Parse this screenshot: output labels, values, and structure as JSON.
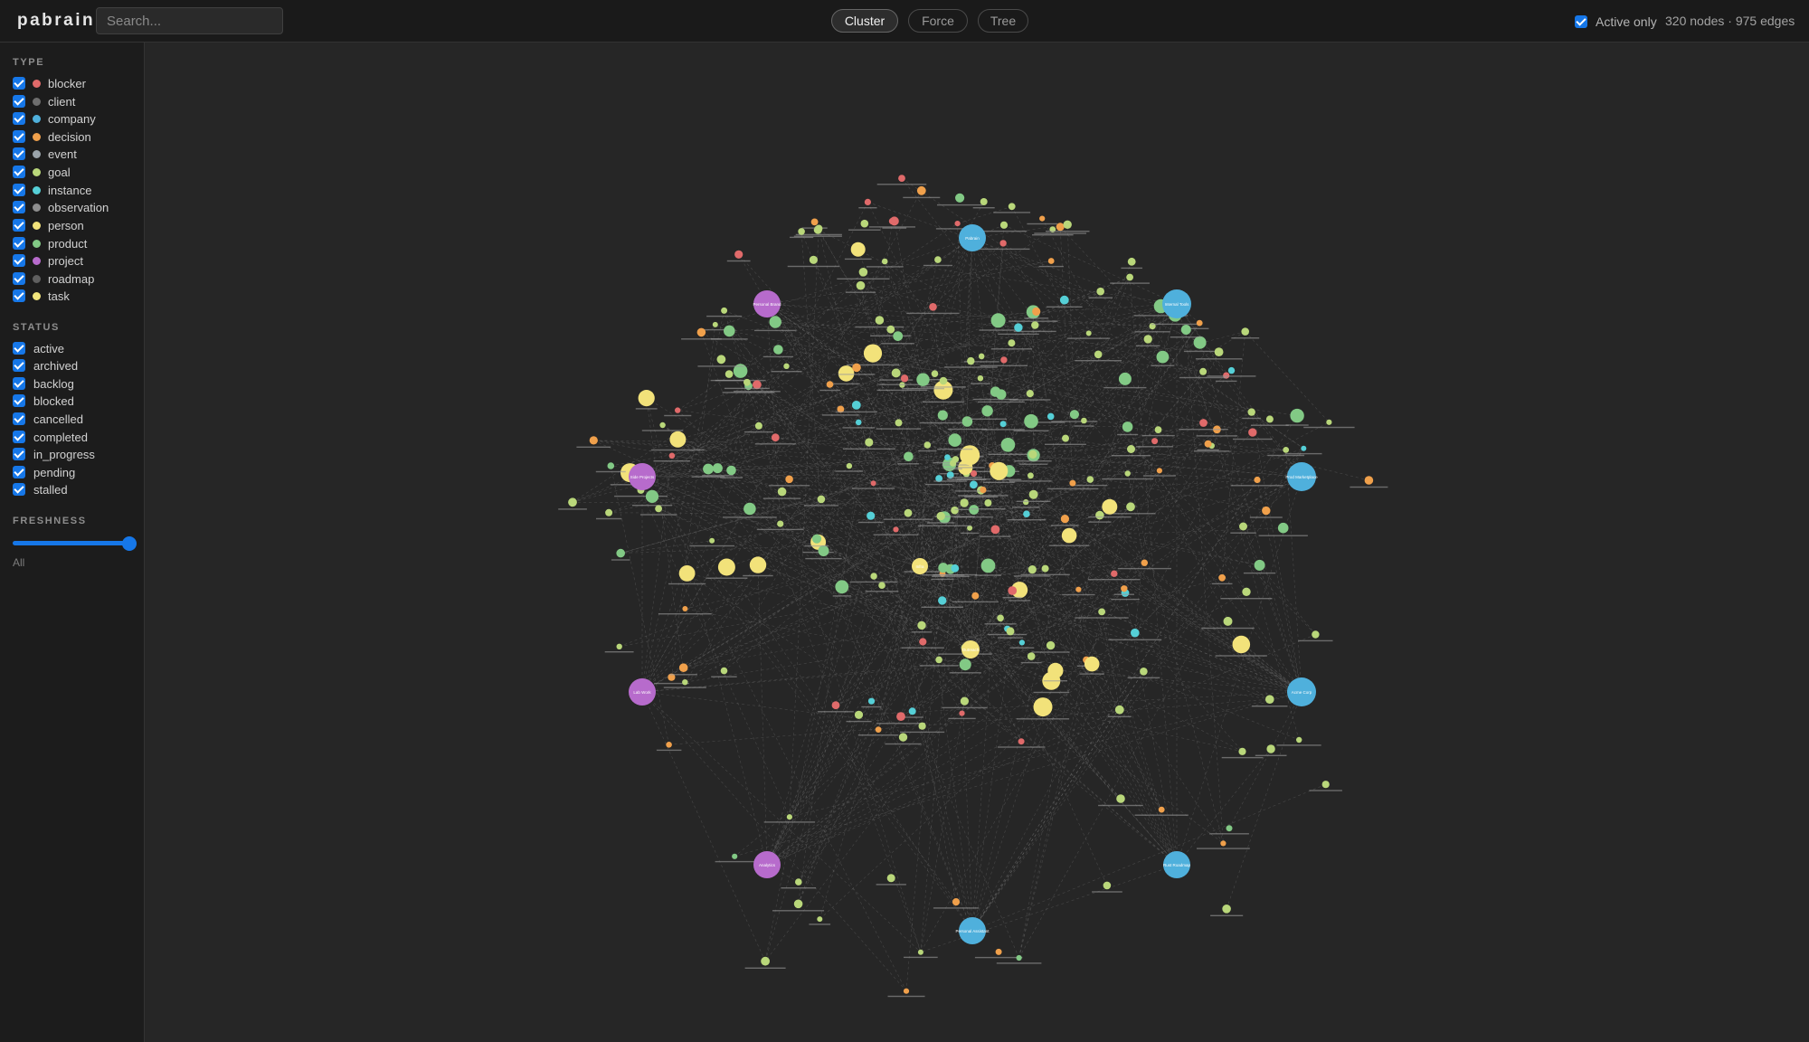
{
  "app": {
    "title": "pabrain"
  },
  "search": {
    "placeholder": "Search..."
  },
  "modes": [
    {
      "label": "Cluster",
      "active": true
    },
    {
      "label": "Force",
      "active": false
    },
    {
      "label": "Tree",
      "active": false
    }
  ],
  "filters": {
    "active_only_label": "Active only",
    "active_only_checked": true
  },
  "stats": {
    "text": "320 nodes · 975 edges",
    "nodes": 320,
    "edges": 975
  },
  "sidebar": {
    "type_heading": "TYPE",
    "types": [
      {
        "label": "blocker",
        "color": "#e06a6a",
        "checked": true
      },
      {
        "label": "client",
        "color": "#6e6e6e",
        "checked": true
      },
      {
        "label": "company",
        "color": "#4fb0dc",
        "checked": true
      },
      {
        "label": "decision",
        "color": "#f0a04b",
        "checked": true
      },
      {
        "label": "event",
        "color": "#9aa3aa",
        "checked": true
      },
      {
        "label": "goal",
        "color": "#b9d77a",
        "checked": true
      },
      {
        "label": "instance",
        "color": "#55cfd6",
        "checked": true
      },
      {
        "label": "observation",
        "color": "#8e8e8e",
        "checked": true
      },
      {
        "label": "person",
        "color": "#f2e27a",
        "checked": true
      },
      {
        "label": "product",
        "color": "#82c985",
        "checked": true
      },
      {
        "label": "project",
        "color": "#b76bcc",
        "checked": true
      },
      {
        "label": "roadmap",
        "color": "#5f5f5f",
        "checked": true
      },
      {
        "label": "task",
        "color": "#f2e57c",
        "checked": true
      }
    ],
    "status_heading": "STATUS",
    "statuses": [
      {
        "label": "active",
        "checked": true
      },
      {
        "label": "archived",
        "checked": true
      },
      {
        "label": "backlog",
        "checked": true
      },
      {
        "label": "blocked",
        "checked": true
      },
      {
        "label": "cancelled",
        "checked": true
      },
      {
        "label": "completed",
        "checked": true
      },
      {
        "label": "in_progress",
        "checked": true
      },
      {
        "label": "pending",
        "checked": true
      },
      {
        "label": "stalled",
        "checked": true
      }
    ],
    "freshness_heading": "FRESHNESS",
    "freshness_value": "All",
    "freshness_level": 1.0
  },
  "graph": {
    "colors": {
      "edge": "#707070",
      "company": "#4fb0dc",
      "project": "#b76bcc",
      "person": "#f2e27a",
      "product": "#82c985",
      "goal": "#b9d77a",
      "decision": "#f0a04b",
      "blocker": "#e06a6a",
      "instance": "#55cfd6"
    },
    "hub_labels": [
      "Pabrain",
      "Internal Tools",
      "Prod Marketplace",
      "Acme Corp",
      "Rust Roadmap",
      "Personal Assistant",
      "Personal Brand",
      "Side Projects",
      "Lab Work",
      "Analytics",
      "Outreach",
      "Infra"
    ]
  }
}
